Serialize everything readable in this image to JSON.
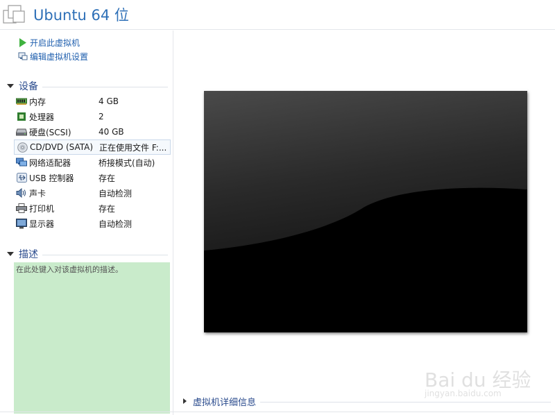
{
  "window": {
    "title": "Ubuntu 64 位"
  },
  "actions": {
    "power_on": "开启此虚拟机",
    "edit_settings": "编辑虚拟机设置"
  },
  "devices_section": {
    "title": "设备",
    "items": [
      {
        "name": "内存",
        "value": "4 GB",
        "icon": "memory-icon"
      },
      {
        "name": "处理器",
        "value": "2",
        "icon": "cpu-icon"
      },
      {
        "name": "硬盘(SCSI)",
        "value": "40 GB",
        "icon": "hard-disk-icon"
      },
      {
        "name": "CD/DVD (SATA)",
        "value": "正在使用文件 F:...",
        "icon": "cd-dvd-icon"
      },
      {
        "name": "网络适配器",
        "value": "桥接模式(自动)",
        "icon": "network-adapter-icon"
      },
      {
        "name": "USB 控制器",
        "value": "存在",
        "icon": "usb-icon"
      },
      {
        "name": "声卡",
        "value": "自动检测",
        "icon": "sound-card-icon"
      },
      {
        "name": "打印机",
        "value": "存在",
        "icon": "printer-icon"
      },
      {
        "name": "显示器",
        "value": "自动检测",
        "icon": "display-icon"
      }
    ]
  },
  "description_section": {
    "title": "描述",
    "placeholder": "在此处键入对该虚拟机的描述。"
  },
  "details_section": {
    "title": "虚拟机详细信息"
  },
  "watermark": {
    "text": "Bai du 经验",
    "sub": "jingyan.baidu.com"
  },
  "colors": {
    "title": "#2d6fb7",
    "link": "#1f5fae",
    "section": "#2a4b8d",
    "description_bg": "#c9ebcb"
  }
}
